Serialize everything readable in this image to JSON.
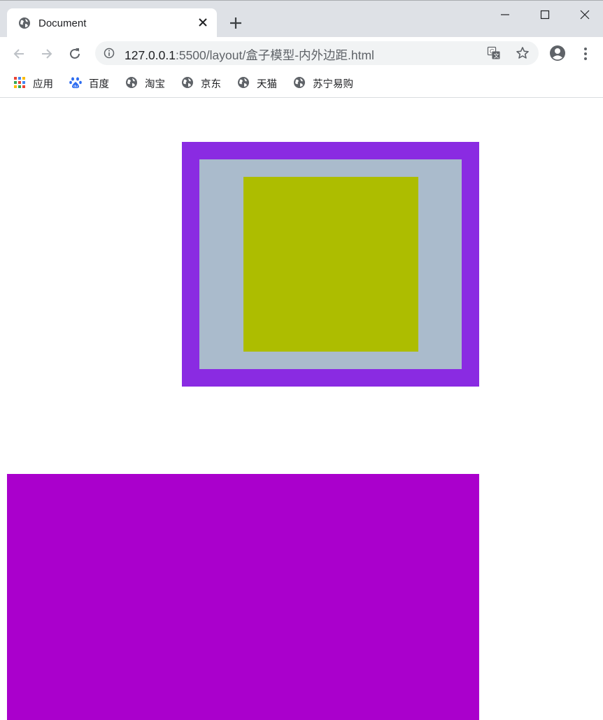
{
  "tab": {
    "title": "Document",
    "globe_icon": "globe-icon",
    "close_icon": "close-icon",
    "new_tab_icon": "plus-icon"
  },
  "window": {
    "minimize_icon": "minimize-icon",
    "maximize_icon": "maximize-icon",
    "close_icon": "close-icon"
  },
  "toolbar": {
    "back_icon": "arrow-left-icon",
    "forward_icon": "arrow-right-icon",
    "reload_icon": "reload-icon",
    "url_host": "127.0.0.1",
    "url_rest": ":5500/layout/盒子模型-内外边距.html",
    "info_icon": "info-icon",
    "translate_icon": "translate-icon",
    "star_icon": "star-icon",
    "profile_icon": "profile-icon",
    "menu_icon": "kebab-menu-icon"
  },
  "bookmarks": [
    {
      "label": "应用",
      "icon": "apps-grid-icon"
    },
    {
      "label": "百度",
      "icon": "baidu-paw-icon"
    },
    {
      "label": "淘宝",
      "icon": "globe-icon"
    },
    {
      "label": "京东",
      "icon": "globe-icon"
    },
    {
      "label": "天猫",
      "icon": "globe-icon"
    },
    {
      "label": "苏宁易购",
      "icon": "globe-icon"
    }
  ],
  "colors": {
    "outer_border": "#8a2be2",
    "outer_background": "#aabbcc",
    "inner_box": "#adbd00",
    "bottom_box": "#aa00cc",
    "chrome_tabstrip": "#dee1e6"
  }
}
